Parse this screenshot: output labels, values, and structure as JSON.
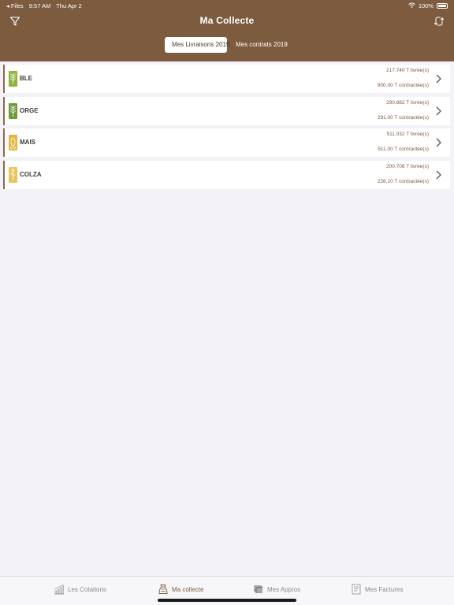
{
  "status_bar": {
    "back_app": "◂ Files",
    "time": "9:57 AM",
    "date": "Thu Apr 2",
    "battery": "100%"
  },
  "header": {
    "title": "Ma Collecte"
  },
  "segments": {
    "livraisons": "Mes Livraisons 2019",
    "contrats": "Mes contrats 2019"
  },
  "colors": {
    "brand": "#7d5b3e",
    "ble": "#8db33a",
    "orge": "#6e9a3a",
    "mais": "#e6b540",
    "colza": "#e9c25a"
  },
  "crops": [
    {
      "name": "BLE",
      "delivered": "217.740 T livrée(s)",
      "contracted": "900.00 T contractée(s)",
      "icon": "wheat-icon"
    },
    {
      "name": "ORGE",
      "delivered": "290.882 T livrée(s)",
      "contracted": "291.00 T contractée(s)",
      "icon": "barley-icon"
    },
    {
      "name": "MAIS",
      "delivered": "511.032 T livrée(s)",
      "contracted": "511.00 T contractée(s)",
      "icon": "corn-icon"
    },
    {
      "name": "COLZA",
      "delivered": "200.708 T livrée(s)",
      "contracted": "226.10 T contractée(s)",
      "icon": "rapeseed-icon"
    }
  ],
  "tabs": {
    "cotations": "Les Cotations",
    "collecte": "Ma collecte",
    "appros": "Mes Appros",
    "factures": "Mes Factures"
  }
}
